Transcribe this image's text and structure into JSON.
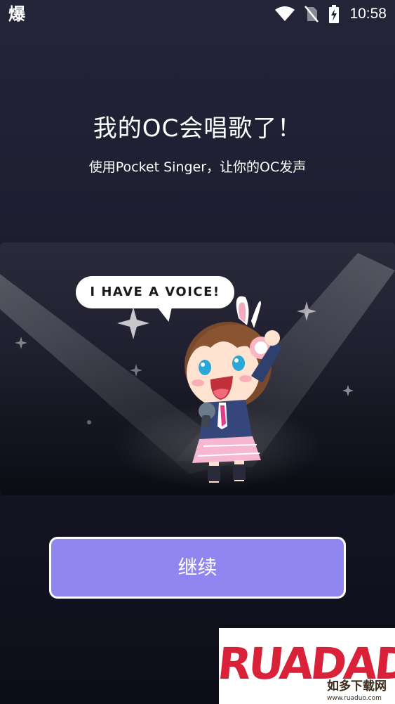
{
  "status_bar": {
    "app_glyph": "爆",
    "time": "10:58",
    "icons": [
      "wifi-icon",
      "no-sim-icon",
      "battery-charging-icon"
    ]
  },
  "intro": {
    "title": "我的OC会唱歌了！",
    "subtitle": "使用Pocket Singer，让你的OC发声"
  },
  "illustration": {
    "speech_bubble": "I HAVE A VOICE!"
  },
  "actions": {
    "continue_label": "继续"
  },
  "watermark": {
    "logo_text": "RUADADO",
    "caption": "如多下载网",
    "url": "www.ruaduo.com"
  },
  "colors": {
    "button": "#8f86ef",
    "background_top": "#25253a",
    "background_bottom": "#0e0e1a"
  }
}
